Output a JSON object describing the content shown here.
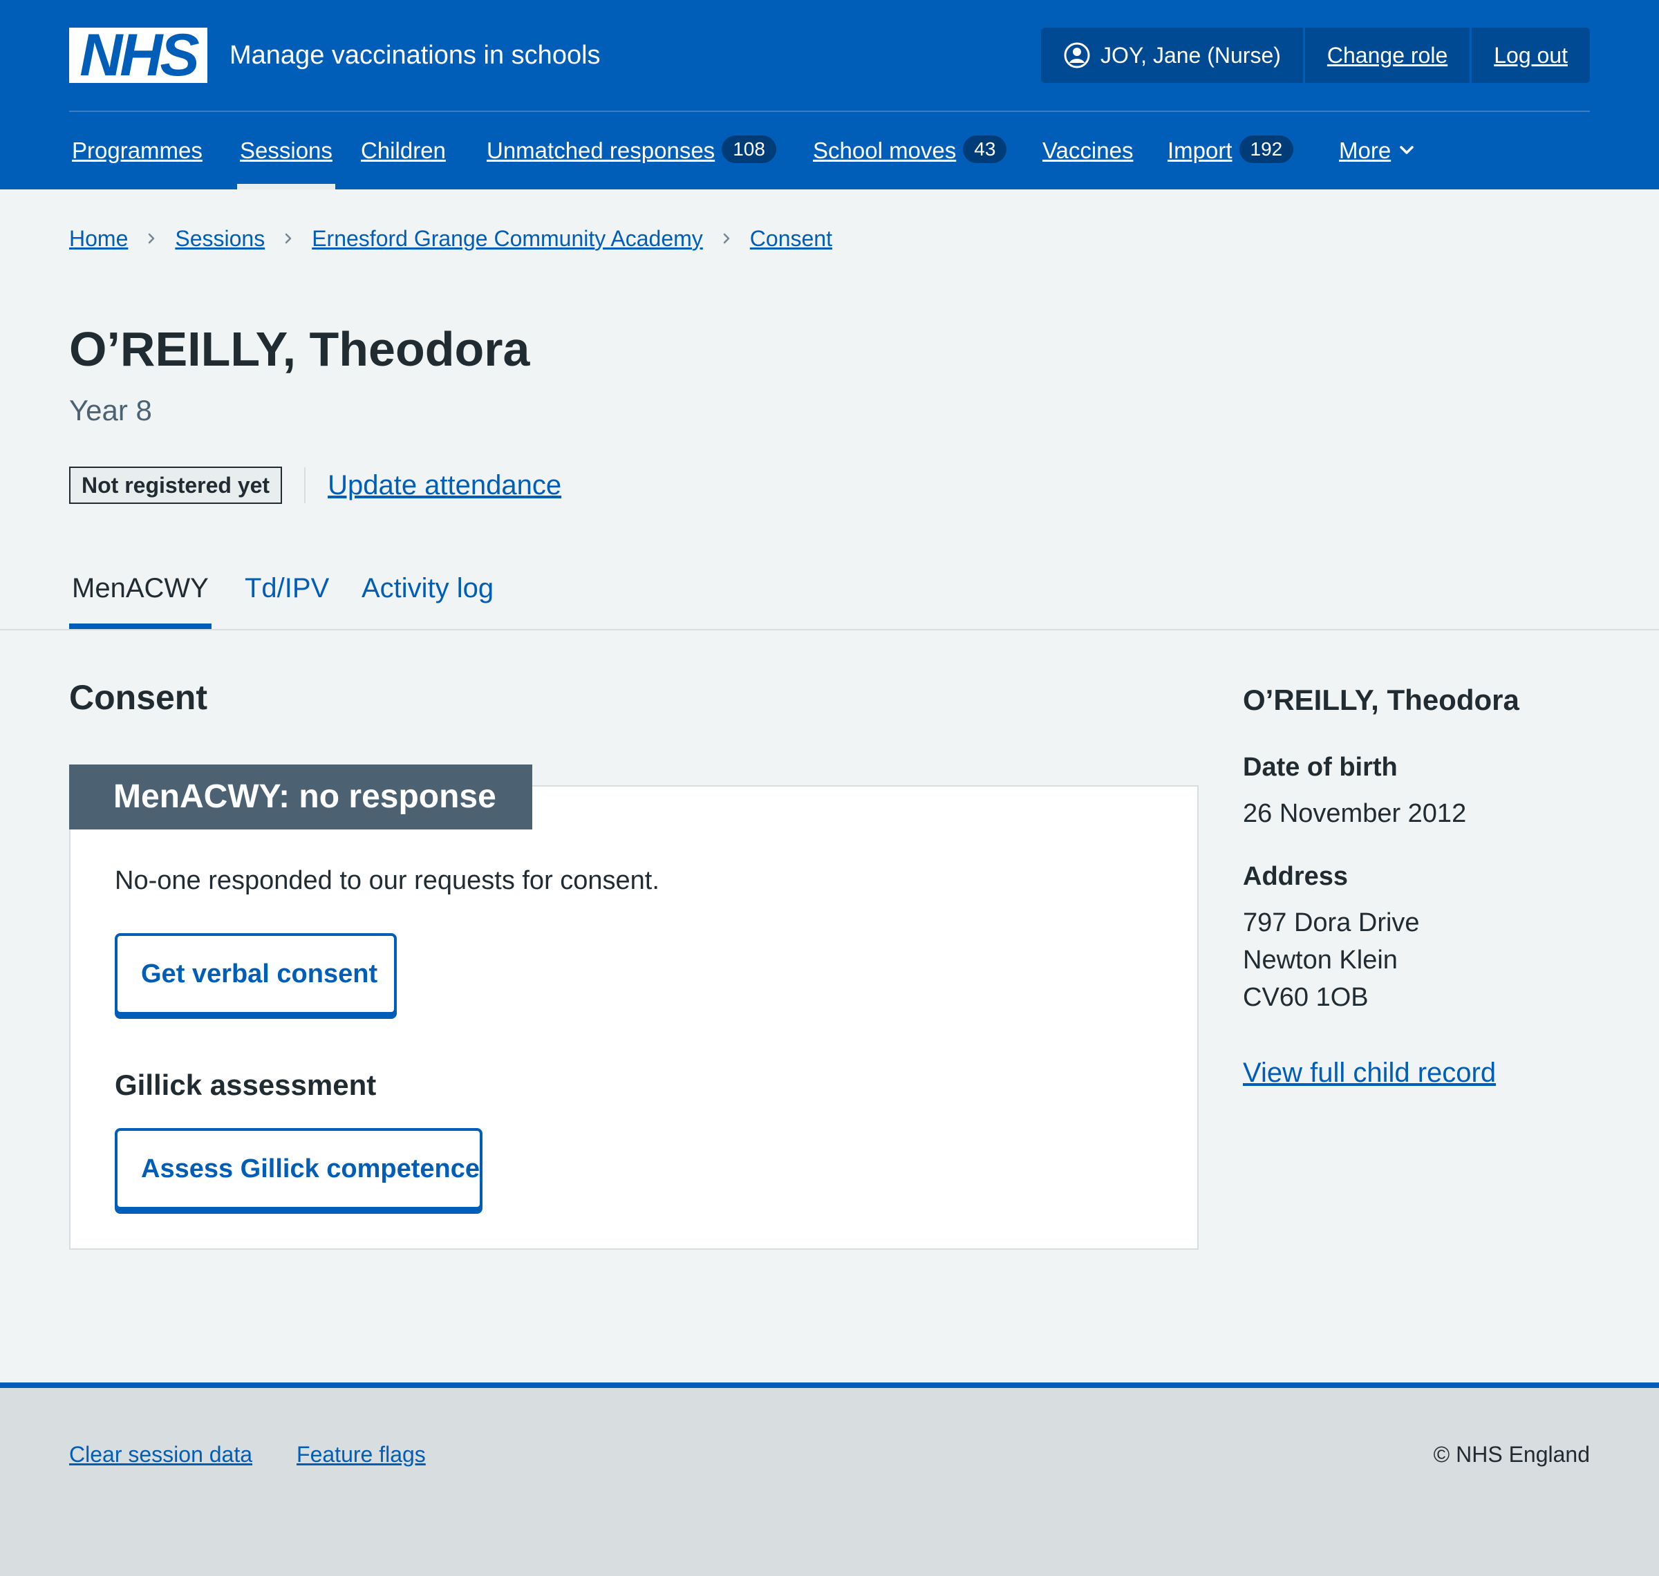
{
  "header": {
    "logo": "NHS",
    "service_name": "Manage vaccinations in schools",
    "user": "JOY, Jane (Nurse)",
    "change_role": "Change role",
    "log_out": "Log out"
  },
  "nav": {
    "items": [
      {
        "label": "Programmes"
      },
      {
        "label": "Sessions",
        "active": true
      },
      {
        "label": "Children"
      },
      {
        "label": "Unmatched responses",
        "count": "108"
      },
      {
        "label": "School moves",
        "count": "43"
      },
      {
        "label": "Vaccines"
      },
      {
        "label": "Import",
        "count": "192"
      },
      {
        "label": "More"
      }
    ]
  },
  "breadcrumb": [
    "Home",
    "Sessions",
    "Ernesford Grange Community Academy",
    "Consent"
  ],
  "page": {
    "title": "O’REILLY, Theodora",
    "caption": "Year 8",
    "status_tag": "Not registered yet",
    "attendance_link": "Update attendance"
  },
  "tabs": [
    {
      "label": "MenACWY",
      "active": true
    },
    {
      "label": "Td/IPV"
    },
    {
      "label": "Activity log"
    }
  ],
  "main": {
    "section_title": "Consent",
    "card": {
      "heading": "MenACWY: no response",
      "text": "No-one responded to our requests for consent.",
      "verbal_button": "Get verbal consent",
      "gillick_heading": "Gillick assessment",
      "gillick_button": "Assess Gillick competence"
    }
  },
  "sidebar": {
    "name": "O’REILLY, Theodora",
    "dob_label": "Date of birth",
    "dob": "26 November 2012",
    "address_label": "Address",
    "address": [
      "797 Dora Drive",
      "Newton Klein",
      "CV60 1OB"
    ],
    "record_link": "View full child record"
  },
  "footer": {
    "clear": "Clear session data",
    "flags": "Feature flags",
    "copyright": "© NHS England"
  },
  "colors": {
    "brand_blue": "#005eb8",
    "header_dark": "#004a94",
    "card_heading": "#4c6272",
    "page_bg": "#f0f4f5"
  },
  "icons": [
    "user-icon",
    "chevron-down-icon",
    "chevron-right-icon"
  ]
}
